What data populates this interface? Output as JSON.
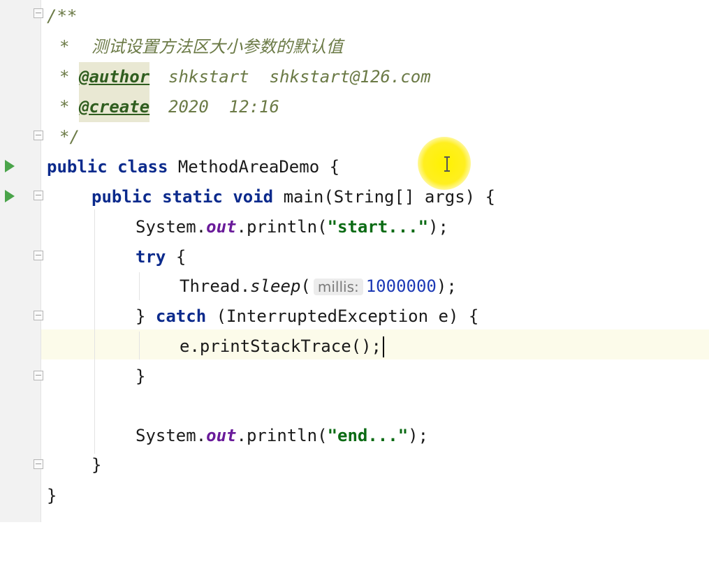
{
  "editor": {
    "comment": {
      "open": "/**",
      "star": "*",
      "description": "测试设置方法区大小参数的默认值",
      "author_tag": "@author",
      "author_value": "shkstart  shkstart@126.com",
      "create_tag": "@create",
      "create_value": "2020  12:16",
      "close": "*/"
    },
    "class_decl": {
      "kw_public": "public",
      "kw_class": "class",
      "name": "MethodAreaDemo",
      "brace": "{"
    },
    "main_decl": {
      "kw_public": "public",
      "kw_static": "static",
      "kw_void": "void",
      "signature": "main(String[] args) {"
    },
    "println_start": {
      "prefix": "System.",
      "field": "out",
      "method": ".println(",
      "string": "\"start...\"",
      "suffix": ");"
    },
    "try_line": {
      "kw": "try",
      "brace": "{"
    },
    "sleep_line": {
      "prefix": "Thread.",
      "method": "sleep",
      "paren": "(",
      "hint": "millis:",
      "number": "1000000",
      "suffix": ");"
    },
    "catch_line": {
      "brace": "}",
      "kw": "catch",
      "rest": "(InterruptedException e) {"
    },
    "print_stack": {
      "text": "e.printStackTrace();"
    },
    "close_try": {
      "text": "}"
    },
    "println_end": {
      "prefix": "System.",
      "field": "out",
      "method": ".println(",
      "string": "\"end...\"",
      "suffix": ");"
    },
    "close_main": {
      "text": "}"
    },
    "close_class": {
      "text": "}"
    }
  }
}
